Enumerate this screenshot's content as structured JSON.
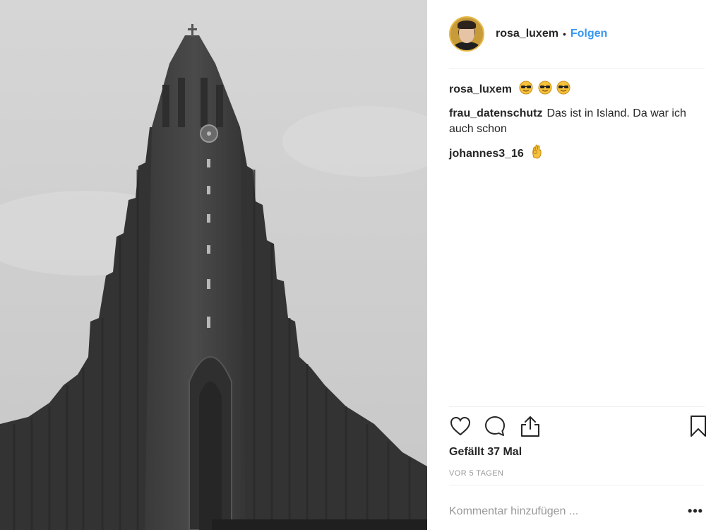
{
  "post": {
    "author": "rosa_luxem",
    "separator": "•",
    "follow_label": "Folgen"
  },
  "comments": [
    {
      "user": "rosa_luxem",
      "text": "",
      "emojis": [
        "sunglasses-face",
        "sunglasses-face",
        "sunglasses-face"
      ]
    },
    {
      "user": "frau_datenschutz",
      "text": "Das ist in Island. Da war ich auch schon",
      "emojis": []
    },
    {
      "user": "johannes3_16",
      "text": "",
      "emojis": [
        "ok-hand"
      ]
    }
  ],
  "likes_text": "Gefällt 37 Mal",
  "timestamp": "VOR 5 TAGEN",
  "comment_box": {
    "placeholder": "Kommentar hinzufügen ..."
  },
  "more_label": "•••",
  "colors": {
    "link": "#3897f0",
    "text": "#262626",
    "muted": "#999999",
    "divider": "#efefef"
  }
}
